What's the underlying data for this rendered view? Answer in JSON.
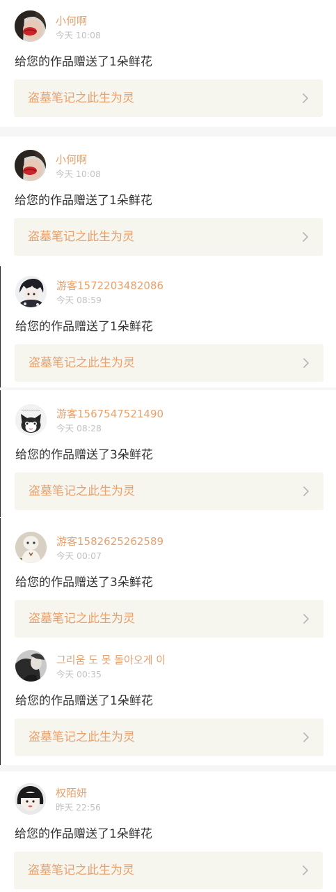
{
  "notifications": [
    {
      "username": "小何啊",
      "time": "今天 10:08",
      "message": "给您的作品赠送了1朵鲜花",
      "work_title": "盗墓笔记之此生为灵",
      "avatar": "avatar-red-lips"
    },
    {
      "username": "小何啊",
      "time": "今天 10:08",
      "message": "给您的作品赠送了1朵鲜花",
      "work_title": "盗墓笔记之此生为灵",
      "avatar": "avatar-red-lips"
    },
    {
      "username": "游客1572203482086",
      "time": "今天 08:59",
      "message": "给您的作品赠送了1朵鲜花",
      "work_title": "盗墓笔记之此生为灵",
      "avatar": "avatar-anime-boy"
    },
    {
      "username": "游客1567547521490",
      "time": "今天 08:28",
      "message": "给您的作品赠送了3朵鲜花",
      "work_title": "盗墓笔记之此生为灵",
      "avatar": "avatar-cat"
    },
    {
      "username": "游客1582625262589",
      "time": "今天 00:07",
      "message": "给您的作品赠送了3朵鲜花",
      "work_title": "盗墓笔记之此生为灵",
      "avatar": "avatar-cartoon-figure"
    },
    {
      "username": "그리움 도 못 돌아오게 이",
      "time": "今天 00:35",
      "message": "给您的作品赠送了1朵鲜花",
      "work_title": "盗墓笔记之此生为灵",
      "avatar": "avatar-dark-portrait"
    },
    {
      "username": "权陌妍",
      "time": "昨天 22:56",
      "message": "给您的作品赠送了1朵鲜花",
      "work_title": "盗墓笔记之此生为灵",
      "avatar": "avatar-girl-bangs"
    }
  ],
  "colors": {
    "accent": "#e8a06c",
    "time_gray": "#c2c2c2",
    "text": "#333333",
    "link_bg": "#f6f5ee",
    "divider": "#f6f6f6"
  },
  "icons": {
    "chevron": "chevron-right-icon"
  }
}
